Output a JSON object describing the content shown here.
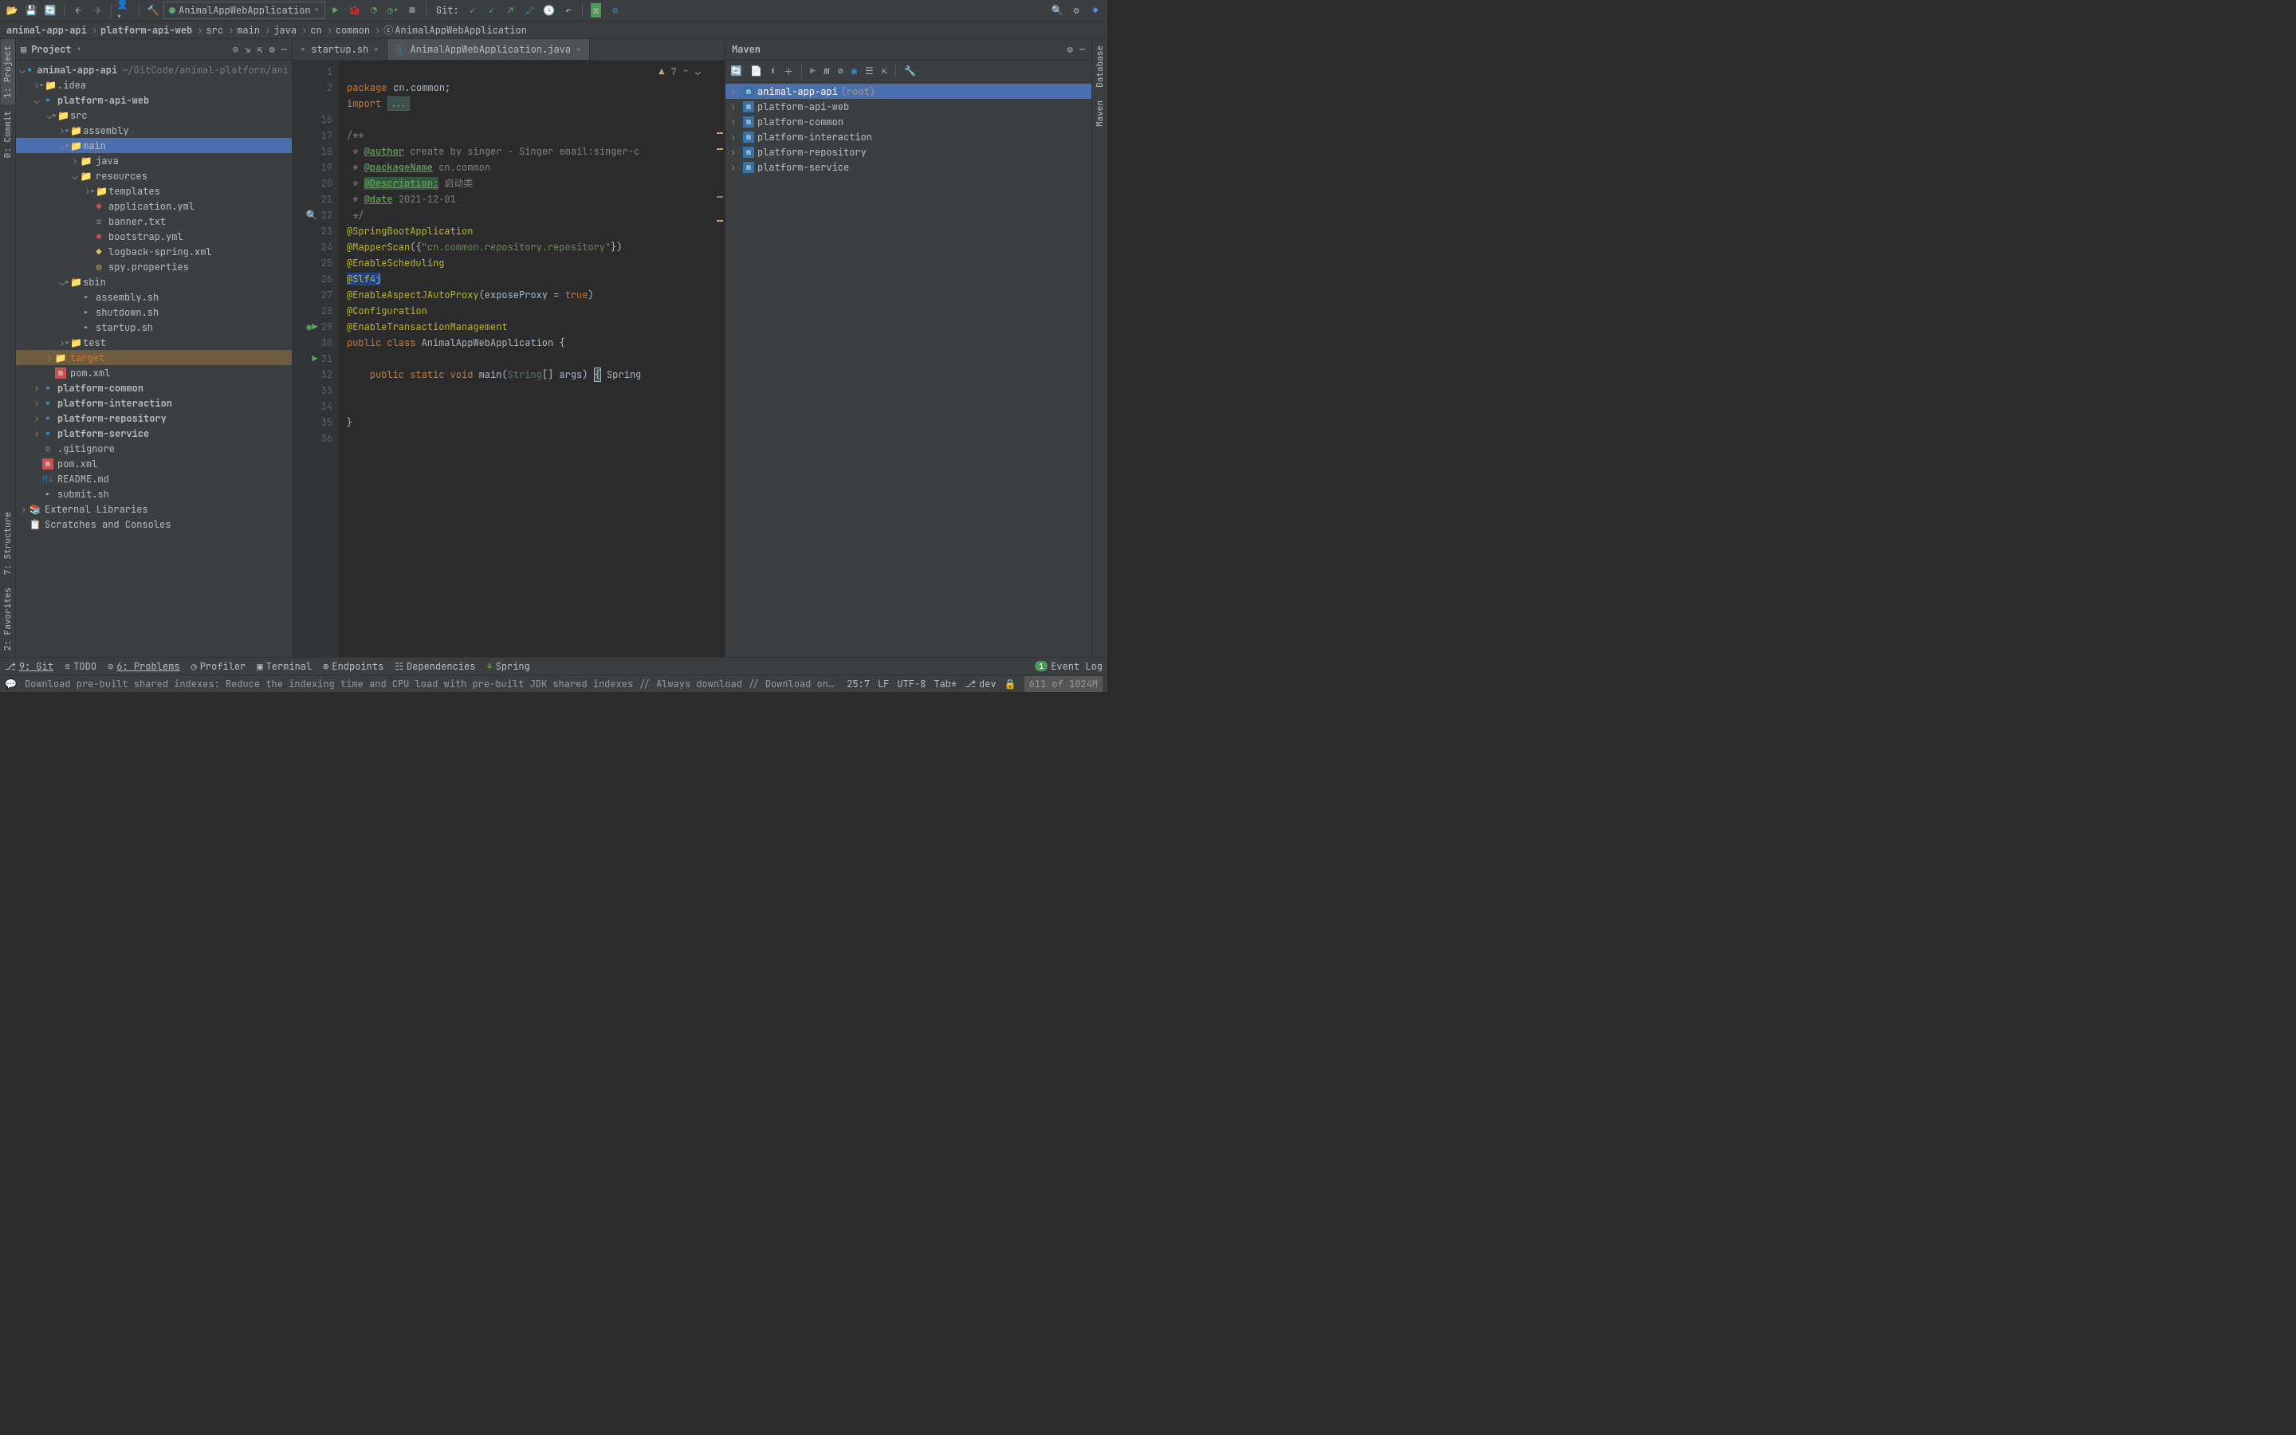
{
  "toolbar": {
    "run_config": "AnimalAppWebApplication",
    "git_label": "Git:"
  },
  "breadcrumbs": [
    "animal-app-api",
    "platform-api-web",
    "src",
    "main",
    "java",
    "cn",
    "common",
    "AnimalAppWebApplication"
  ],
  "sidebar": {
    "title": "Project",
    "root": {
      "name": "animal-app-api",
      "path": "~/GitCode/animal-platform/ani"
    },
    "nodes": [
      {
        "indent": 1,
        "arrow": "›",
        "icon": "folder",
        "label": ".idea"
      },
      {
        "indent": 1,
        "arrow": "⌄",
        "icon": "module",
        "label": "platform-api-web",
        "bold": true
      },
      {
        "indent": 2,
        "arrow": "⌄",
        "icon": "folder",
        "label": "src"
      },
      {
        "indent": 3,
        "arrow": "›",
        "icon": "folder",
        "label": "assembly"
      },
      {
        "indent": 3,
        "arrow": "⌄",
        "icon": "folder",
        "label": "main",
        "selected": true
      },
      {
        "indent": 4,
        "arrow": "›",
        "icon": "folder-blue",
        "label": "java"
      },
      {
        "indent": 4,
        "arrow": "⌄",
        "icon": "folder-res",
        "label": "resources"
      },
      {
        "indent": 5,
        "arrow": "›",
        "icon": "folder",
        "label": "templates"
      },
      {
        "indent": 5,
        "arrow": "",
        "icon": "yml",
        "label": "application.yml"
      },
      {
        "indent": 5,
        "arrow": "",
        "icon": "txt",
        "label": "banner.txt"
      },
      {
        "indent": 5,
        "arrow": "",
        "icon": "yml",
        "label": "bootstrap.yml"
      },
      {
        "indent": 5,
        "arrow": "",
        "icon": "xml",
        "label": "logback-spring.xml"
      },
      {
        "indent": 5,
        "arrow": "",
        "icon": "prop",
        "label": "spy.properties"
      },
      {
        "indent": 3,
        "arrow": "⌄",
        "icon": "folder",
        "label": "sbin"
      },
      {
        "indent": 4,
        "arrow": "",
        "icon": "sh",
        "label": "assembly.sh"
      },
      {
        "indent": 4,
        "arrow": "",
        "icon": "sh",
        "label": "shutdown.sh"
      },
      {
        "indent": 4,
        "arrow": "",
        "icon": "sh",
        "label": "startup.sh"
      },
      {
        "indent": 3,
        "arrow": "›",
        "icon": "folder",
        "label": "test"
      },
      {
        "indent": 2,
        "arrow": "›",
        "icon": "folder-orange",
        "label": "target",
        "highlighted": true
      },
      {
        "indent": 2,
        "arrow": "",
        "icon": "maven",
        "label": "pom.xml"
      },
      {
        "indent": 1,
        "arrow": "›",
        "icon": "module",
        "label": "platform-common",
        "bold": true
      },
      {
        "indent": 1,
        "arrow": "›",
        "icon": "module",
        "label": "platform-interaction",
        "bold": true
      },
      {
        "indent": 1,
        "arrow": "›",
        "icon": "module",
        "label": "platform-repository",
        "bold": true
      },
      {
        "indent": 1,
        "arrow": "›",
        "icon": "module",
        "label": "platform-service",
        "bold": true
      },
      {
        "indent": 1,
        "arrow": "",
        "icon": "txt",
        "label": ".gitignore"
      },
      {
        "indent": 1,
        "arrow": "",
        "icon": "maven",
        "label": "pom.xml"
      },
      {
        "indent": 1,
        "arrow": "",
        "icon": "md",
        "label": "README.md"
      },
      {
        "indent": 1,
        "arrow": "",
        "icon": "sh",
        "label": "submit.sh"
      }
    ],
    "external": "External Libraries",
    "scratches": "Scratches and Consoles"
  },
  "editor": {
    "tabs": [
      {
        "name": "startup.sh",
        "active": false
      },
      {
        "name": "AnimalAppWebApplication.java",
        "active": true
      }
    ],
    "warn_count": "7",
    "lines": {
      "start": 1,
      "end": 36,
      "l1_kw": "package",
      "l1_pkg": "cn.common",
      "l1_semi": ";",
      "l2_kw": "import",
      "l2_fold": "...",
      "l16": "/**",
      "l17_pre": " * ",
      "l17_tag": "@author",
      "l17_txt": " create by singer - Singer email:singer-c",
      "l18_pre": " * ",
      "l18_tag": "@packageName",
      "l18_txt": " cn.common",
      "l19_pre": " * ",
      "l19_tag": "@Description:",
      "l19_txt": " 启动类",
      "l20_pre": " * ",
      "l20_tag": "@date",
      "l20_txt": " 2021-12-01",
      "l21": " */",
      "l22": "@SpringBootApplication",
      "l23a": "@MapperScan",
      "l23b": "({",
      "l23c": "\"cn.common.repository.repository\"",
      "l23d": "})",
      "l24": "@EnableScheduling",
      "l25": "@Slf4j",
      "l26a": "@EnableAspectJAutoProxy",
      "l26b": "(exposeProxy = ",
      "l26c": "true",
      "l26d": ")",
      "l27": "@Configuration",
      "l28": "@EnableTransactionManagement",
      "l29a": "public class ",
      "l29b": "AnimalAppWebApplication",
      "l29c": " {",
      "l31a": "    public static void ",
      "l31b": "main",
      "l31c": "(",
      "l31d": "String",
      "l31e": "[] args) ",
      "l31f": "{",
      "l31g": " Spring",
      "l35": "}"
    }
  },
  "maven": {
    "title": "Maven",
    "modules": [
      {
        "name": "animal-app-api",
        "suffix": "(root)",
        "selected": true
      },
      {
        "name": "platform-api-web"
      },
      {
        "name": "platform-common"
      },
      {
        "name": "platform-interaction"
      },
      {
        "name": "platform-repository"
      },
      {
        "name": "platform-service"
      }
    ]
  },
  "left_rail": [
    "1: Project",
    "0: Commit",
    "7: Structure",
    "2: Favorites"
  ],
  "right_rail": [
    "Database",
    "Maven"
  ],
  "bottom": {
    "tabs": [
      "9: Git",
      "TODO",
      "6: Problems",
      "Profiler",
      "Terminal",
      "Endpoints",
      "Dependencies",
      "Spring"
    ],
    "event_log": "Event Log",
    "event_count": "1"
  },
  "status": {
    "msg": "Download pre-built shared indexes: Reduce the indexing time and CPU load with pre-built JDK shared indexes // Always download // Download once // Don't show again // Configure... (moments ago)",
    "cursor": "25:7",
    "line_ending": "LF",
    "encoding": "UTF-8",
    "indent": "Tab*",
    "branch": "dev",
    "memory": "611 of 1024M"
  }
}
